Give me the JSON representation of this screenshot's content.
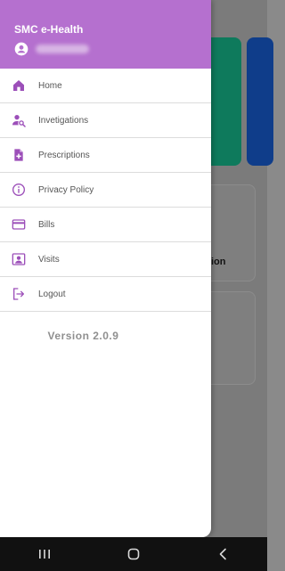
{
  "drawer": {
    "app_title": "SMC e-Health",
    "version": "Version 2.0.9",
    "items": [
      {
        "label": "Home",
        "icon": "home-icon"
      },
      {
        "label": "Invetigations",
        "icon": "person-search-icon"
      },
      {
        "label": "Prescriptions",
        "icon": "prescription-file-icon"
      },
      {
        "label": "Privacy Policy",
        "icon": "info-icon"
      },
      {
        "label": "Bills",
        "icon": "credit-card-icon"
      },
      {
        "label": "Visits",
        "icon": "contact-card-icon"
      },
      {
        "label": "Logout",
        "icon": "logout-icon"
      }
    ]
  },
  "background": {
    "partial_label": "ion"
  },
  "colors": {
    "header": "#b570cf",
    "icon": "#9c4fb9",
    "text": "#555555",
    "version": "#8f8f8f"
  }
}
